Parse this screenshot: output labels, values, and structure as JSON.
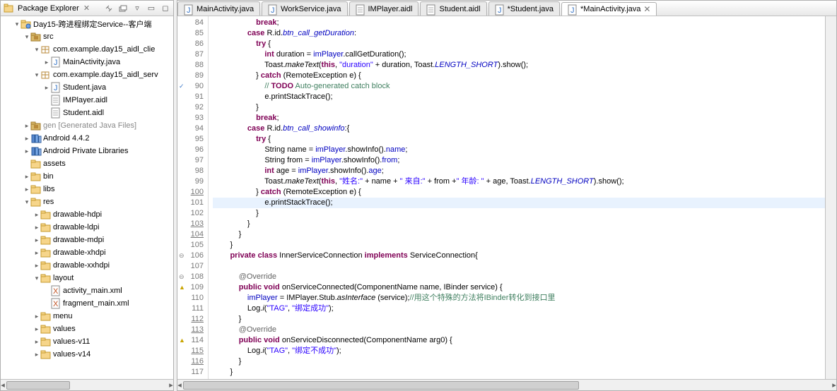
{
  "sidebar": {
    "title": "Package Explorer",
    "project": "Day15-跨进程绑定Service--客户端",
    "nodes": [
      {
        "depth": 1,
        "twisty": "▾",
        "icon": "project",
        "label": "Day15-跨进程绑定Service--客户端"
      },
      {
        "depth": 2,
        "twisty": "▾",
        "icon": "srcfolder",
        "label": "src"
      },
      {
        "depth": 3,
        "twisty": "▾",
        "icon": "package",
        "label": "com.example.day15_aidl_clie"
      },
      {
        "depth": 4,
        "twisty": "▸",
        "icon": "jfile",
        "label": "MainActivity.java"
      },
      {
        "depth": 3,
        "twisty": "▾",
        "icon": "package",
        "label": "com.example.day15_aidl_serv"
      },
      {
        "depth": 4,
        "twisty": "▸",
        "icon": "jfile",
        "label": "Student.java"
      },
      {
        "depth": 4,
        "twisty": "",
        "icon": "file",
        "label": "IMPlayer.aidl"
      },
      {
        "depth": 4,
        "twisty": "",
        "icon": "file",
        "label": "Student.aidl"
      },
      {
        "depth": 2,
        "twisty": "▸",
        "icon": "srcfolder",
        "label": "gen [Generated Java Files]",
        "gray": true
      },
      {
        "depth": 2,
        "twisty": "▸",
        "icon": "lib",
        "label": "Android 4.4.2"
      },
      {
        "depth": 2,
        "twisty": "▸",
        "icon": "lib",
        "label": "Android Private Libraries"
      },
      {
        "depth": 2,
        "twisty": "",
        "icon": "folder",
        "label": "assets"
      },
      {
        "depth": 2,
        "twisty": "▸",
        "icon": "folder",
        "label": "bin"
      },
      {
        "depth": 2,
        "twisty": "▸",
        "icon": "folder",
        "label": "libs"
      },
      {
        "depth": 2,
        "twisty": "▾",
        "icon": "folder",
        "label": "res"
      },
      {
        "depth": 3,
        "twisty": "▸",
        "icon": "folder",
        "label": "drawable-hdpi"
      },
      {
        "depth": 3,
        "twisty": "▸",
        "icon": "folder",
        "label": "drawable-ldpi"
      },
      {
        "depth": 3,
        "twisty": "▸",
        "icon": "folder",
        "label": "drawable-mdpi"
      },
      {
        "depth": 3,
        "twisty": "▸",
        "icon": "folder",
        "label": "drawable-xhdpi"
      },
      {
        "depth": 3,
        "twisty": "▸",
        "icon": "folder",
        "label": "drawable-xxhdpi"
      },
      {
        "depth": 3,
        "twisty": "▾",
        "icon": "folder",
        "label": "layout"
      },
      {
        "depth": 4,
        "twisty": "",
        "icon": "xfile",
        "label": "activity_main.xml"
      },
      {
        "depth": 4,
        "twisty": "",
        "icon": "xfile",
        "label": "fragment_main.xml"
      },
      {
        "depth": 3,
        "twisty": "▸",
        "icon": "folder",
        "label": "menu"
      },
      {
        "depth": 3,
        "twisty": "▸",
        "icon": "folder",
        "label": "values"
      },
      {
        "depth": 3,
        "twisty": "▸",
        "icon": "folder",
        "label": "values-v11"
      },
      {
        "depth": 3,
        "twisty": "▸",
        "icon": "folder",
        "label": "values-v14"
      }
    ]
  },
  "tabs": [
    {
      "icon": "jfile",
      "label": "MainActivity.java",
      "dirty": false,
      "active": false
    },
    {
      "icon": "jfile",
      "label": "WorkService.java",
      "dirty": false,
      "active": false
    },
    {
      "icon": "file",
      "label": "IMPlayer.aidl",
      "dirty": false,
      "active": false
    },
    {
      "icon": "file",
      "label": "Student.aidl",
      "dirty": false,
      "active": false
    },
    {
      "icon": "jfile",
      "label": "*Student.java",
      "dirty": true,
      "active": false
    },
    {
      "icon": "jfile",
      "label": "*MainActivity.java",
      "dirty": true,
      "active": true
    }
  ],
  "editor": {
    "first_line": 84,
    "highlight_line": 101,
    "underlined_lines": [
      100,
      103,
      104,
      112,
      113,
      115,
      116
    ],
    "task_lines": [
      90
    ],
    "warn_lines": [
      109,
      114
    ],
    "lines": [
      {
        "n": 84,
        "t": "                    <kw>break</kw>;"
      },
      {
        "n": 85,
        "t": "                <kw>case</kw> R.id.<fld sf>btn_call_getDuration</fld>:"
      },
      {
        "n": 86,
        "t": "                    <kw>try</kw> {"
      },
      {
        "n": 87,
        "t": "                        <kw>int</kw> duration = <fld>imPlayer</fld>.callGetDuration();"
      },
      {
        "n": 88,
        "t": "                        Toast.<sf>makeText</sf>(<kw>this</kw>, <str>\"duration\"</str> + duration, Toast.<fld sf>LENGTH_SHORT</fld>).show();"
      },
      {
        "n": 89,
        "t": "                    } <kw>catch</kw> (RemoteException e) {"
      },
      {
        "n": 90,
        "t": "                        <cm>// <kw>TODO</kw> Auto-generated catch block</cm>"
      },
      {
        "n": 91,
        "t": "                        e.printStackTrace();"
      },
      {
        "n": 92,
        "t": "                    }"
      },
      {
        "n": 93,
        "t": "                    <kw>break</kw>;"
      },
      {
        "n": 94,
        "t": "                <kw>case</kw> R.id.<fld sf>btn_call_showinfo</fld>:{"
      },
      {
        "n": 95,
        "t": "                    <kw>try</kw> {"
      },
      {
        "n": 96,
        "t": "                        String name = <fld>imPlayer</fld>.showInfo().<fld>name</fld>;"
      },
      {
        "n": 97,
        "t": "                        String from = <fld>imPlayer</fld>.showInfo().<fld>from</fld>;"
      },
      {
        "n": 98,
        "t": "                        <kw>int</kw> age = <fld>imPlayer</fld>.showInfo().<fld>age</fld>;"
      },
      {
        "n": 99,
        "t": "                        Toast.<sf>makeText</sf>(<kw>this</kw>, <str>\"姓名:\"</str> + name + <str>\" 来自:\"</str> + from +<str>\" 年龄: \"</str> + age, Toast.<fld sf>LENGTH_SHORT</fld>).show();"
      },
      {
        "n": 100,
        "t": "                    } <kw>catch</kw> (RemoteException e) {"
      },
      {
        "n": 101,
        "t": "                        e.printStackTrace();"
      },
      {
        "n": 102,
        "t": "                    }"
      },
      {
        "n": 103,
        "t": "                }"
      },
      {
        "n": 104,
        "t": "            }"
      },
      {
        "n": 105,
        "t": "        }"
      },
      {
        "n": 106,
        "t": "        <kw>private</kw> <kw>class</kw> InnerServiceConnection <kw>implements</kw> ServiceConnection{"
      },
      {
        "n": 107,
        "t": ""
      },
      {
        "n": 108,
        "t": "            <an>@Override</an>"
      },
      {
        "n": 109,
        "t": "            <kw>public</kw> <kw>void</kw> onServiceConnected(ComponentName name, IBinder service) {"
      },
      {
        "n": 110,
        "t": "                <fld>imPlayer</fld> = IMPlayer.Stub.<sf>asInterface</sf> (service);<cm>//用这个特殊的方法将IBinder转化到接口里</cm>"
      },
      {
        "n": 111,
        "t": "                Log.<sf>i</sf>(<str>\"TAG\"</str>, <str>\"绑定成功\"</str>);"
      },
      {
        "n": 112,
        "t": "            }"
      },
      {
        "n": 113,
        "t": "            <an>@Override</an>"
      },
      {
        "n": 114,
        "t": "            <kw>public</kw> <kw>void</kw> onServiceDisconnected(ComponentName arg0) {"
      },
      {
        "n": 115,
        "t": "                Log.<sf>i</sf>(<str>\"TAG\"</str>, <str>\"绑定不成功\"</str>);"
      },
      {
        "n": 116,
        "t": "            }"
      },
      {
        "n": 117,
        "t": "        }"
      }
    ]
  }
}
